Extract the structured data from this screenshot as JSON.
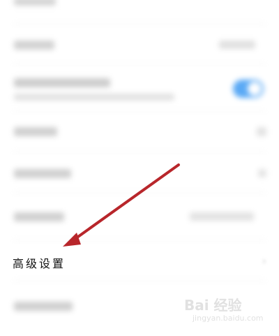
{
  "settings_list": {
    "advanced_settings_label": "高级设置"
  },
  "watermark": {
    "brand": "Bai 经验",
    "url": "jingyan.baidu.com"
  },
  "colors": {
    "arrow": "#b8262b",
    "toggle_on": "#5aa9f5"
  }
}
